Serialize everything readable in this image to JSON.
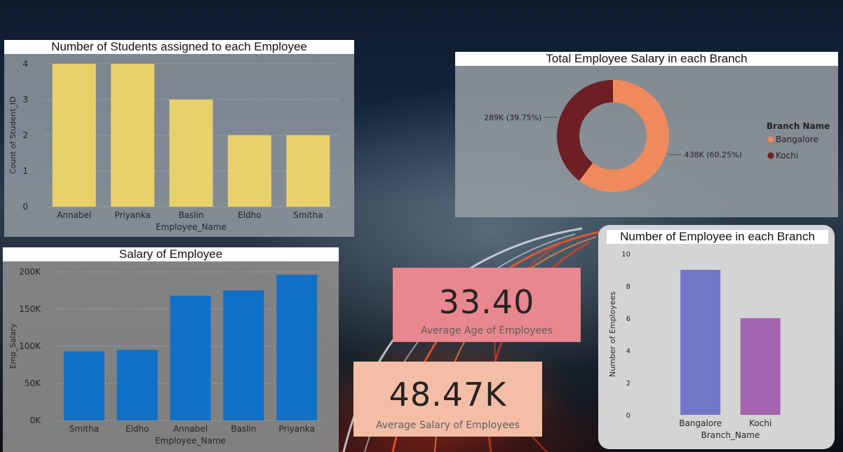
{
  "chart_data": [
    {
      "type": "bar",
      "title": "Number of Students assigned to each Employee",
      "categories": [
        "Annabel",
        "Priyanka",
        "Baslin",
        "Eldho",
        "Smitha"
      ],
      "values": [
        4,
        4,
        3,
        2,
        2
      ],
      "xlabel": "Employee_Name",
      "ylabel": "Count of Student_ID",
      "yticks": [
        "0",
        "1",
        "2",
        "3",
        "4"
      ],
      "ylim": [
        0,
        4
      ],
      "color": "#e8d06a",
      "grid": true
    },
    {
      "type": "bar",
      "title": "Salary of Employee",
      "categories": [
        "Smitha",
        "Eldho",
        "Annabel",
        "Baslin",
        "Priyanka"
      ],
      "values": [
        93000,
        95000,
        168000,
        175000,
        196000
      ],
      "xlabel": "Employee_Name",
      "ylabel": "Emp_Salary",
      "yticks": [
        "0K",
        "50K",
        "100K",
        "150K",
        "200K"
      ],
      "ylim": [
        0,
        200000
      ],
      "color": "#1170c8",
      "grid": true
    },
    {
      "type": "pie",
      "subtype": "donut",
      "title": "Total Employee Salary in each Branch",
      "legend_title": "Branch Name",
      "legend_position": "right",
      "slices": [
        {
          "name": "Bangalore",
          "value": 438,
          "label": "438K (60.25%)",
          "color": "#ef8a5c"
        },
        {
          "name": "Kochi",
          "value": 289,
          "label": "289K (39.75%)",
          "color": "#6d1f24"
        }
      ]
    },
    {
      "type": "bar",
      "title": "Number of Employee in each Branch",
      "categories": [
        "Bangalore",
        "Kochi"
      ],
      "values": [
        9,
        6
      ],
      "colors": [
        "#7377c8",
        "#a464b0"
      ],
      "xlabel": "Branch_Name",
      "ylabel": "Number of Employees",
      "yticks": [
        "0",
        "2",
        "4",
        "6",
        "8",
        "10"
      ],
      "ylim": [
        0,
        10
      ],
      "grid": false
    }
  ],
  "kpis": {
    "age": {
      "value": "33.40",
      "label": "Average Age of Employees",
      "bg": "#e8878d"
    },
    "salary": {
      "value": "48.47K",
      "label": "Average Salary of Employees",
      "bg": "#f4bea6"
    }
  }
}
